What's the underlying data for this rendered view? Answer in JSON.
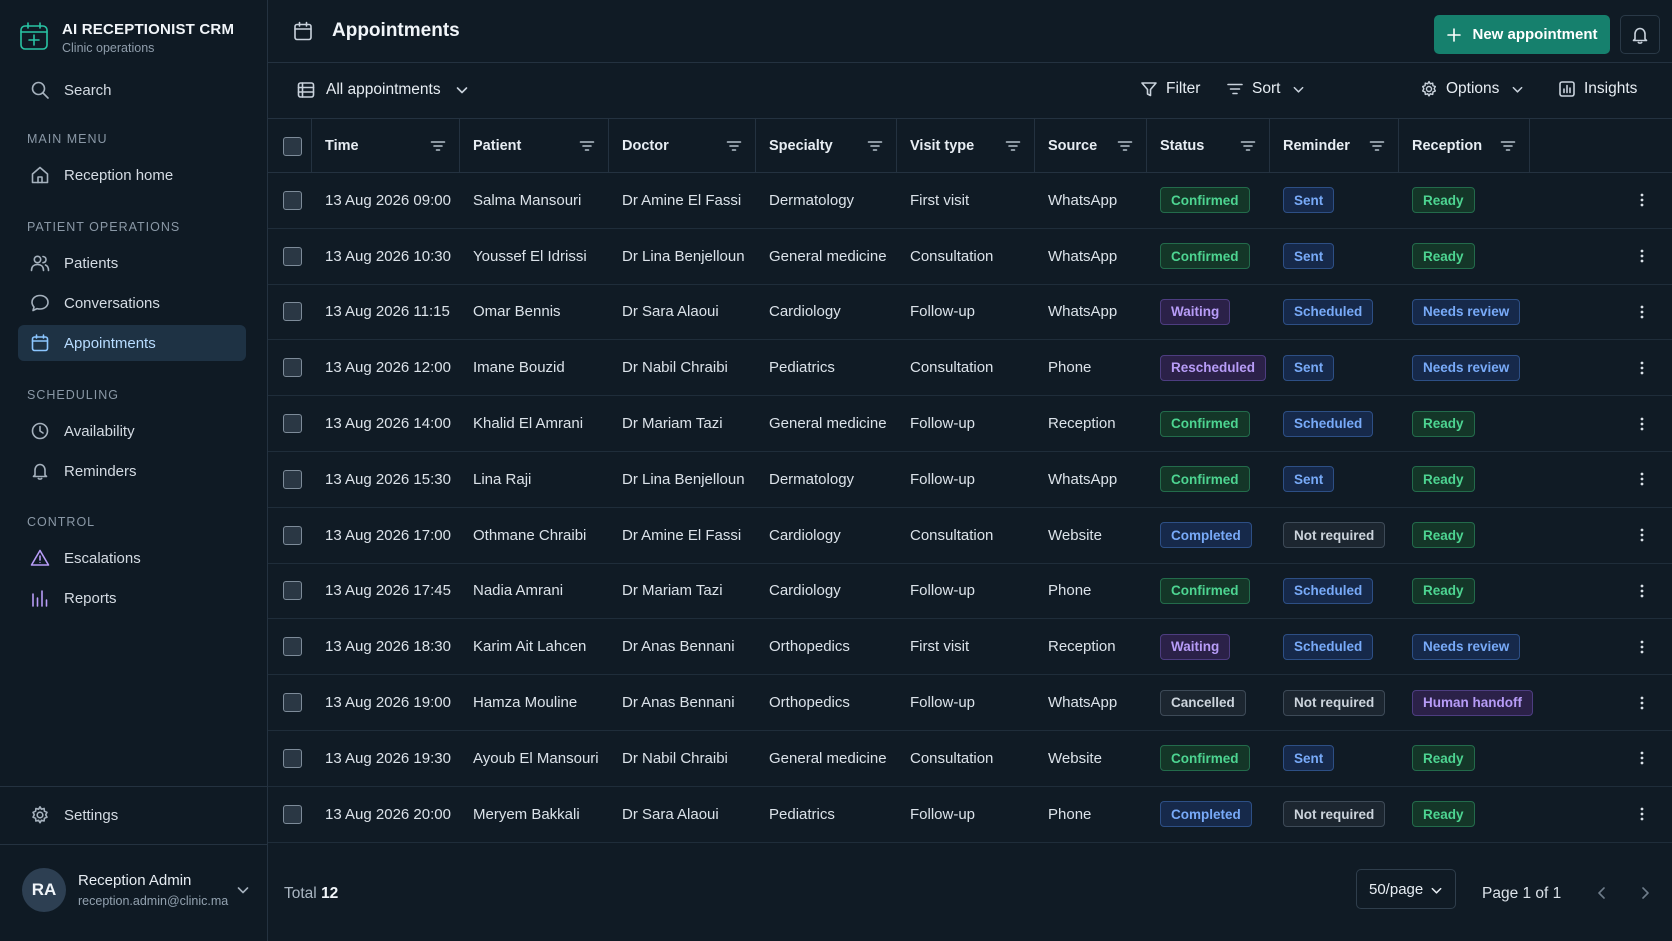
{
  "brand": {
    "title": "AI RECEPTIONIST CRM",
    "subtitle": "Clinic operations"
  },
  "sidebar": {
    "search_label": "Search",
    "sections": {
      "main": "MAIN MENU",
      "patient_ops": "PATIENT OPERATIONS",
      "scheduling": "SCHEDULING",
      "control": "CONTROL"
    },
    "items": {
      "reception_home": "Reception home",
      "patients": "Patients",
      "conversations": "Conversations",
      "appointments": "Appointments",
      "availability": "Availability",
      "reminders": "Reminders",
      "escalations": "Escalations",
      "reports": "Reports",
      "settings": "Settings"
    },
    "active_item": "Appointments",
    "user": {
      "initials": "RA",
      "name": "Reception Admin",
      "email": "reception.admin@clinic.ma"
    }
  },
  "header": {
    "title": "Appointments",
    "new_button": "New appointment"
  },
  "toolbar": {
    "view": "All appointments",
    "filter": "Filter",
    "sort": "Sort",
    "options": "Options",
    "insights": "Insights"
  },
  "table": {
    "columns": [
      "Time",
      "Patient",
      "Doctor",
      "Specialty",
      "Visit type",
      "Source",
      "Status",
      "Reminder",
      "Reception"
    ],
    "rows": [
      [
        "13 Aug 2026 09:00",
        "Salma Mansouri",
        "Dr Amine El Fassi",
        "Dermatology",
        "First visit",
        "WhatsApp",
        "Confirmed",
        "Sent",
        "Ready"
      ],
      [
        "13 Aug 2026 10:30",
        "Youssef El Idrissi",
        "Dr Lina Benjelloun",
        "General medicine",
        "Consultation",
        "WhatsApp",
        "Confirmed",
        "Sent",
        "Ready"
      ],
      [
        "13 Aug 2026 11:15",
        "Omar Bennis",
        "Dr Sara Alaoui",
        "Cardiology",
        "Follow-up",
        "WhatsApp",
        "Waiting",
        "Scheduled",
        "Needs review"
      ],
      [
        "13 Aug 2026 12:00",
        "Imane Bouzid",
        "Dr Nabil Chraibi",
        "Pediatrics",
        "Consultation",
        "Phone",
        "Rescheduled",
        "Sent",
        "Needs review"
      ],
      [
        "13 Aug 2026 14:00",
        "Khalid El Amrani",
        "Dr Mariam Tazi",
        "General medicine",
        "Follow-up",
        "Reception",
        "Confirmed",
        "Scheduled",
        "Ready"
      ],
      [
        "13 Aug 2026 15:30",
        "Lina Raji",
        "Dr Lina Benjelloun",
        "Dermatology",
        "Follow-up",
        "WhatsApp",
        "Confirmed",
        "Sent",
        "Ready"
      ],
      [
        "13 Aug 2026 17:00",
        "Othmane Chraibi",
        "Dr Amine El Fassi",
        "Cardiology",
        "Consultation",
        "Website",
        "Completed",
        "Not required",
        "Ready"
      ],
      [
        "13 Aug 2026 17:45",
        "Nadia Amrani",
        "Dr Mariam Tazi",
        "Cardiology",
        "Follow-up",
        "Phone",
        "Confirmed",
        "Scheduled",
        "Ready"
      ],
      [
        "13 Aug 2026 18:30",
        "Karim Ait Lahcen",
        "Dr Anas Bennani",
        "Orthopedics",
        "First visit",
        "Reception",
        "Waiting",
        "Scheduled",
        "Needs review"
      ],
      [
        "13 Aug 2026 19:00",
        "Hamza Mouline",
        "Dr Anas Bennani",
        "Orthopedics",
        "Follow-up",
        "WhatsApp",
        "Cancelled",
        "Not required",
        "Human handoff"
      ],
      [
        "13 Aug 2026 19:30",
        "Ayoub El Mansouri",
        "Dr Nabil Chraibi",
        "General medicine",
        "Consultation",
        "Website",
        "Confirmed",
        "Sent",
        "Ready"
      ],
      [
        "13 Aug 2026 20:00",
        "Meryem Bakkali",
        "Dr Sara Alaoui",
        "Pediatrics",
        "Follow-up",
        "Phone",
        "Completed",
        "Not required",
        "Ready"
      ]
    ]
  },
  "badge_colors": {
    "Confirmed": "green",
    "Ready": "green",
    "Waiting": "purple",
    "Rescheduled": "purple",
    "Human handoff": "purple",
    "Sent": "blue",
    "Scheduled": "blue",
    "Needs review": "blue",
    "Completed": "blue",
    "Cancelled": "gray",
    "Not required": "gray"
  },
  "footer": {
    "total_label": "Total",
    "total_value": "12",
    "per_page": "50/page",
    "page_info": "Page 1 of 1"
  },
  "colors": {
    "accent": "#16806d",
    "active_nav": "#1e3244",
    "background": "#101b25"
  }
}
